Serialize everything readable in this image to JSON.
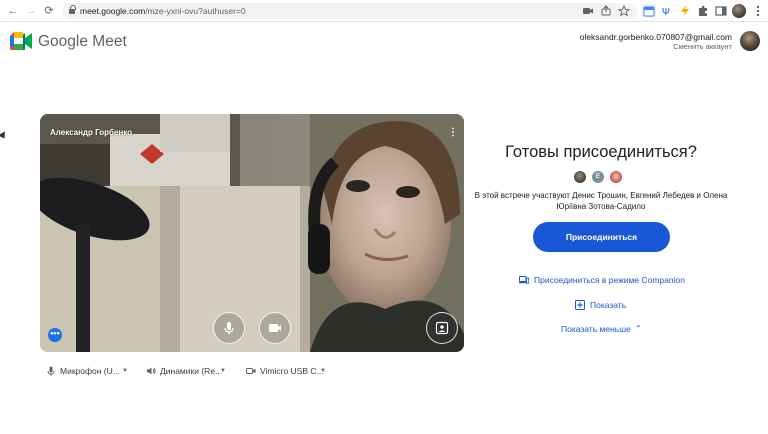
{
  "browser": {
    "url_host": "meet.google.com",
    "url_path": "/mze-yxni-ovu?authuser=0",
    "nav": {
      "back": "←",
      "forward": "→",
      "reload": "⟳"
    }
  },
  "header": {
    "brand_google": "Google",
    "brand_meet": "Meet",
    "account_email": "oleksandr.gorbenko.070807@gmail.com",
    "switch_account": "Сменить аккаунт"
  },
  "preview": {
    "self_name": "Александр Горбенко",
    "more_glyph": "⋮",
    "effects_glyph": "•••"
  },
  "devices": {
    "microphone": "Микрофон (U...",
    "speakers": "Динамики (Re...",
    "camera": "Vimicro USB C..."
  },
  "join": {
    "title": "Готовы присоединиться?",
    "participant_initial": "Е",
    "participants_text": "В этой встрече участвуют Денис Трошин, Евгений Лебедев и Олена Юріївна Зотова-Садило",
    "join_button": "Присоединиться",
    "companion": "Присоединиться в режиме Companion",
    "present": "Показать",
    "show_less": "Показать меньше"
  },
  "colors": {
    "accent": "#1a57d6",
    "effects": "#1a73e8"
  }
}
